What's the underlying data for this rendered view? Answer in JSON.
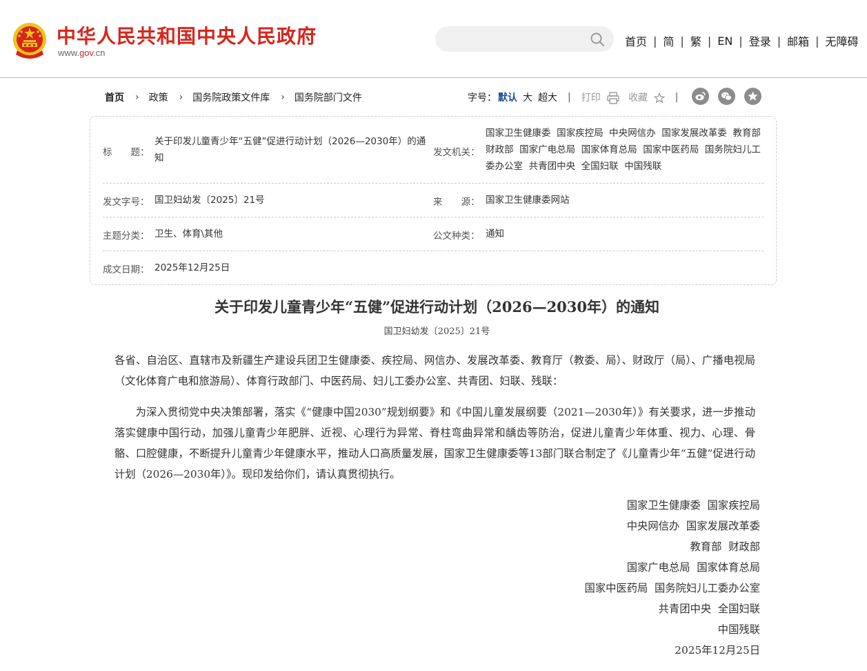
{
  "header": {
    "site_title": "中华人民共和国中央人民政府",
    "domain_prefix": "www.",
    "domain_brand": "gov",
    "domain_suffix": ".cn",
    "search_placeholder": "",
    "nav": [
      "首页",
      "简",
      "繁",
      "EN",
      "登录",
      "邮箱",
      "无障碍"
    ]
  },
  "breadcrumb": [
    "首页",
    "政策",
    "国务院政策文件库",
    "国务院部门文件"
  ],
  "tools": {
    "font_size_label": "字号：",
    "font_sizes": [
      "默认",
      "大",
      "超大"
    ],
    "print_label": "打印",
    "favorite_label": "收藏",
    "share_icons": [
      "weibo-icon",
      "wechat-icon",
      "star-icon"
    ]
  },
  "colors": {
    "brand_red": "#d8241c",
    "active_blue": "#1d4f91"
  },
  "info": {
    "title_label": "标　　题：",
    "title_value": "关于印发儿童青少年“五健”促进行动计划（2026—2030年）的通知",
    "issuer_label": "发文机关：",
    "issuer_value": "国家卫生健康委  国家疾控局  中央网信办  国家发展改革委  教育部  财政部  国家广电总局  国家体育总局  国家中医药局  国务院妇儿工委办公室  共青团中央  全国妇联  中国残联",
    "docno_label": "发文字号：",
    "docno_value": "国卫妇幼发〔2025〕21号",
    "source_label": "来　　源：",
    "source_value": "国家卫生健康委网站",
    "topic_label": "主题分类：",
    "topic_value": "卫生、体育\\其他",
    "type_label": "公文种类：",
    "type_value": "通知",
    "date_label": "成文日期：",
    "date_value": "2025年12月25日"
  },
  "article": {
    "title": "关于印发儿童青少年“五健”促进行动计划（2026—2030年）的通知",
    "number": "国卫妇幼发〔2025〕21号",
    "salutation": "各省、自治区、直辖市及新疆生产建设兵团卫生健康委、疾控局、网信办、发展改革委、教育厅（教委、局）、财政厅（局）、广播电视局（文化体育广电和旅游局）、体育行政部门、中医药局、妇儿工委办公室、共青团、妇联、残联：",
    "body": "为深入贯彻党中央决策部署，落实《“健康中国2030”规划纲要》和《中国儿童发展纲要（2021—2030年）》有关要求，进一步推动落实健康中国行动，加强儿童青少年肥胖、近视、心理行为异常、脊柱弯曲异常和龋齿等防治，促进儿童青少年体重、视力、心理、骨骼、口腔健康，不断提升儿童青少年健康水平，推动人口高质量发展，国家卫生健康委等13部门联合制定了《儿童青少年“五健”促进行动计划（2026—2030年）》。现印发给你们，请认真贯彻执行。",
    "signers": [
      "国家卫生健康委  国家疾控局",
      "中央网信办  国家发展改革委",
      "教育部  财政部",
      "国家广电总局  国家体育总局",
      "国家中医药局  国务院妇儿工委办公室",
      "共青团中央  全国妇联",
      "中国残联",
      "2025年12月25日"
    ]
  }
}
